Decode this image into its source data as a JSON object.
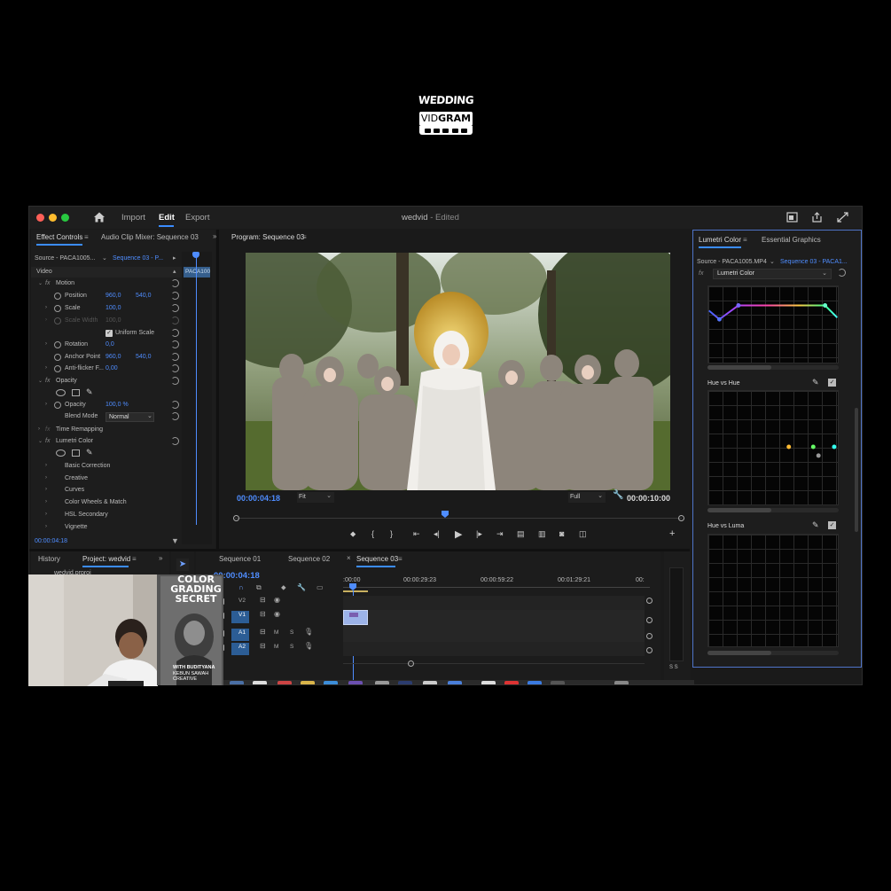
{
  "logo": {
    "line1": "WEDDING",
    "line2a": "VID",
    "line2b": "GRAM"
  },
  "window": {
    "title": "wedvid",
    "title_suffix": "- Edited",
    "nav": {
      "import": "Import",
      "edit": "Edit",
      "export": "Export"
    }
  },
  "effect_controls": {
    "tab": "Effect Controls",
    "tab2": "Audio Clip Mixer: Sequence 03",
    "source": "Source - PACA1005...",
    "sequence": "Sequence 03 - P...",
    "clip": "PACA100",
    "section": "Video",
    "rows": {
      "motion": "Motion",
      "position": "Position",
      "position_x": "960,0",
      "position_y": "540,0",
      "scale": "Scale",
      "scale_val": "100,0",
      "scale_width": "Scale Width",
      "scale_width_val": "100,0",
      "uniform_scale": "Uniform Scale",
      "rotation": "Rotation",
      "rotation_val": "0,0",
      "anchor": "Anchor Point",
      "anchor_x": "960,0",
      "anchor_y": "540,0",
      "antiflicker": "Anti-flicker F...",
      "antiflicker_val": "0,00",
      "opacity_group": "Opacity",
      "opacity": "Opacity",
      "opacity_val": "100,0 %",
      "blend": "Blend Mode",
      "blend_val": "Normal",
      "time_remap": "Time Remapping",
      "lumetri": "Lumetri Color",
      "basic": "Basic Correction",
      "creative": "Creative",
      "curves": "Curves",
      "wheels": "Color Wheels & Match",
      "hsl": "HSL Secondary",
      "vignette": "Vignette"
    },
    "timecode": "00:00:04:18"
  },
  "program": {
    "title": "Program: Sequence 03",
    "timecode": "00:00:04:18",
    "fit": "Fit",
    "full": "Full",
    "duration": "00:00:10:00"
  },
  "lumetri": {
    "tab": "Lumetri Color",
    "tab2": "Essential Graphics",
    "source": "Source - PACA1005.MP4",
    "sequence": "Sequence 03 - PACA1...",
    "effect": "Lumetri Color",
    "hue_vs_hue": "Hue vs Hue",
    "hue_vs_luma": "Hue vs Luma"
  },
  "project": {
    "history": "History",
    "project": "Project: wedvid",
    "file": "wedvid.prproj"
  },
  "timeline": {
    "tabs": [
      "Sequence 01",
      "Sequence 02",
      "Sequence 03"
    ],
    "timecode": "00:00:04:18",
    "ruler": [
      ":00:00",
      "00:00:29:23",
      "00:00:59:22",
      "00:01:29:21",
      "00:"
    ],
    "tracks": [
      "V2",
      "V1",
      "A1",
      "A2"
    ],
    "audio_m": "M",
    "audio_s": "S",
    "meter_label": "S S"
  },
  "overlay": {
    "book_title": "COLOR GRADING SECRET",
    "book_by": "WITH BUDITYANA",
    "book_sub": "KEBUN SAWAH CREATIVE"
  },
  "colors": {
    "accent": "#3b8cff",
    "timecode": "#4f8dff",
    "panel": "#1d1d1d",
    "bg": "#000000"
  }
}
